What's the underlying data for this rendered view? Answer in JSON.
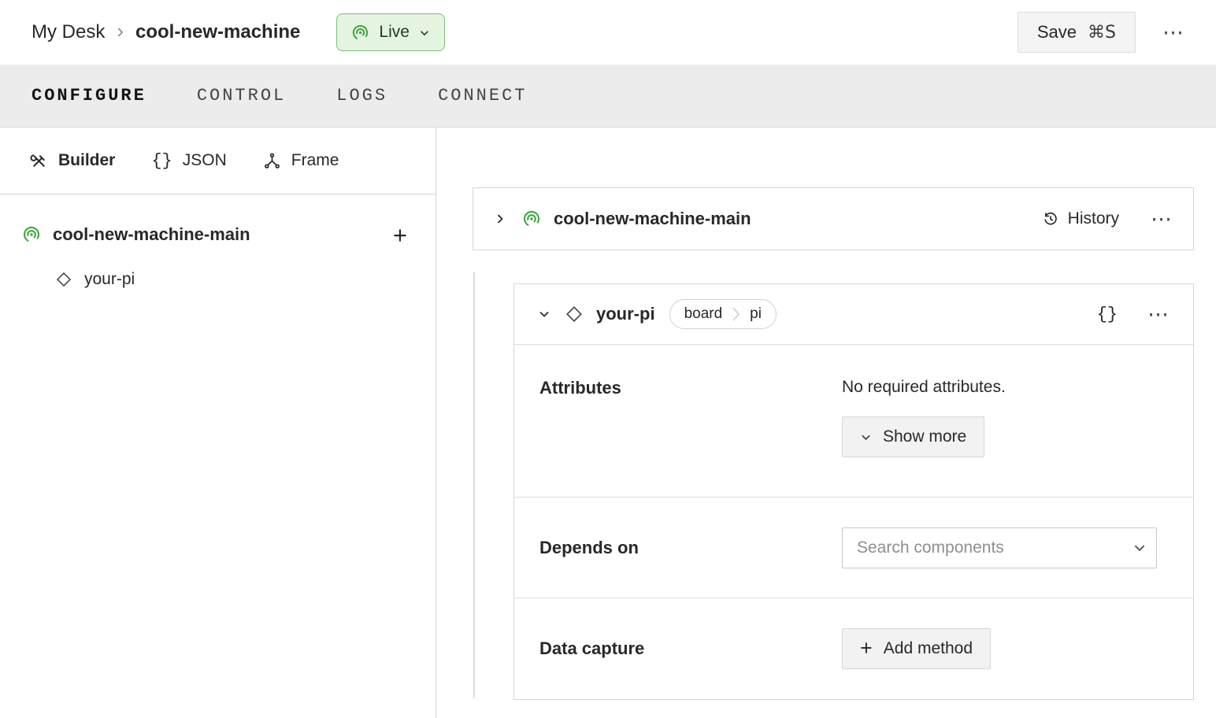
{
  "colors": {
    "accent_green": "#3ca83c",
    "live_bg": "#e5f4e1",
    "live_border": "#74c073",
    "tabbar_bg": "#ececec",
    "border": "#d6d6d6",
    "text": "#282828"
  },
  "header": {
    "breadcrumb": {
      "parent": "My Desk",
      "separator": "›",
      "current": "cool-new-machine"
    },
    "live": {
      "label": "Live"
    },
    "save": {
      "label": "Save",
      "shortcut": "⌘S"
    },
    "more": "⋯"
  },
  "tabs": [
    {
      "label": "CONFIGURE",
      "active": true
    },
    {
      "label": "CONTROL",
      "active": false
    },
    {
      "label": "LOGS",
      "active": false
    },
    {
      "label": "CONNECT",
      "active": false
    }
  ],
  "sidebar": {
    "modes": {
      "builder": "Builder",
      "json": "JSON",
      "json_icon": "{}",
      "frame": "Frame"
    },
    "tree": {
      "root": "cool-new-machine-main",
      "add": "+",
      "child": "your-pi"
    }
  },
  "main": {
    "machine": {
      "title": "cool-new-machine-main",
      "history": "History",
      "more": "⋯"
    },
    "component": {
      "title": "your-pi",
      "type_badge": "board",
      "model_badge": "pi",
      "braces_icon": "{}",
      "more": "⋯",
      "attributes": {
        "label": "Attributes",
        "empty": "No required attributes.",
        "show_more": "Show more"
      },
      "depends": {
        "label": "Depends on",
        "placeholder": "Search components"
      },
      "capture": {
        "label": "Data capture",
        "plus": "+",
        "add_method": "Add method"
      }
    }
  }
}
